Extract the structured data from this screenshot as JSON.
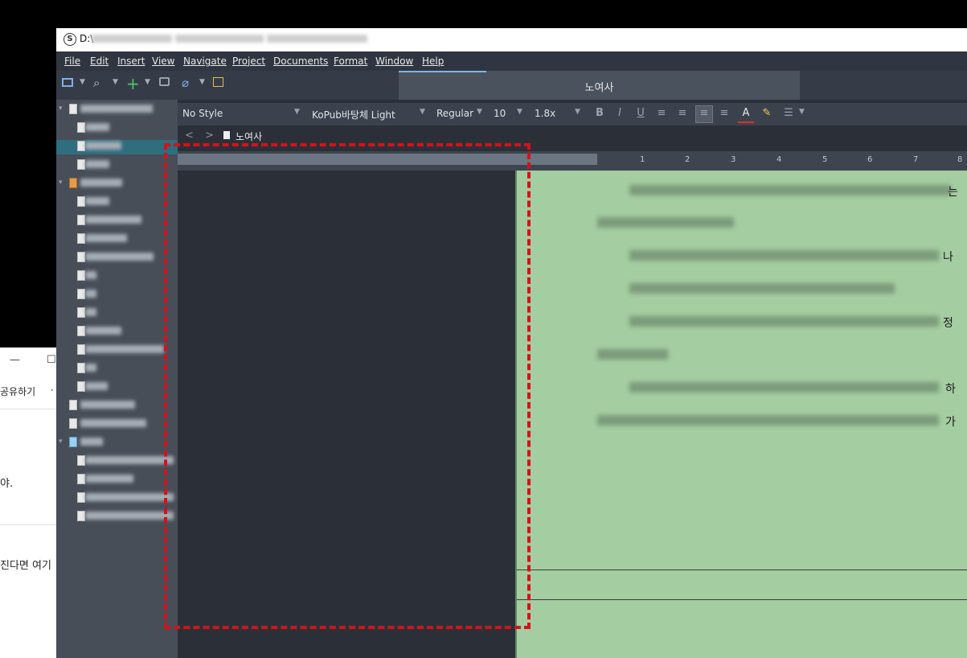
{
  "background_window": {
    "minimize": "—",
    "maximize": "☐",
    "share_label": "공유하기",
    "more": "·",
    "text_line1": "야.",
    "text_line2": "진다면 여기"
  },
  "window": {
    "title_prefix": "D:\\",
    "logo": "S",
    "menu": [
      "File",
      "Edit",
      "Insert",
      "View",
      "Navigate",
      "Project",
      "Documents",
      "Format",
      "Window",
      "Help"
    ],
    "doc_tab": "노여사",
    "format_bar": {
      "style": "No Style",
      "font": "KoPub바탕체 Light",
      "weight": "Regular",
      "size": "10",
      "spacing": "1.8x",
      "bold": "B",
      "italic": "I",
      "underline": "U",
      "text_color": "A"
    },
    "breadcrumb": {
      "back": "<",
      "forward": ">",
      "doc": "노여사"
    },
    "ruler_numbers": [
      "1",
      "2",
      "3",
      "4",
      "5",
      "6",
      "7",
      "8"
    ],
    "editor_line_endings": [
      "는",
      "나",
      "정",
      "하",
      "가"
    ]
  },
  "colors": {
    "accent": "#7ab6e8",
    "page_bg": "#a4cda1",
    "highlight_box": "#d0141b",
    "binder_selection": "#2f6d7f"
  },
  "icons": [
    "binder-toggle-icon",
    "search-icon",
    "add-icon",
    "trash-icon",
    "paperclip-icon",
    "notes-icon",
    "align-left-icon",
    "align-center-icon",
    "justify-icon",
    "align-right-icon",
    "highlighter-icon",
    "list-icon"
  ]
}
